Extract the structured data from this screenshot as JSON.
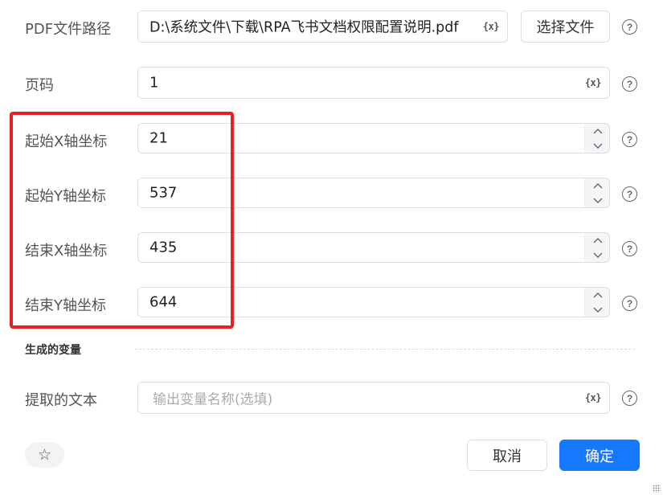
{
  "rows": {
    "pdf_path": {
      "label": "PDF文件路径",
      "value": "D:\\系统文件\\下载\\RPA飞书文档权限配置说明.pdf",
      "var_icon": "{x}",
      "choose_button": "选择文件",
      "help": "?"
    },
    "page": {
      "label": "页码",
      "value": "1",
      "var_icon": "{x}",
      "help": "?"
    },
    "start_x": {
      "label": "起始X轴坐标",
      "value": "21",
      "help": "?"
    },
    "start_y": {
      "label": "起始Y轴坐标",
      "value": "537",
      "help": "?"
    },
    "end_x": {
      "label": "结束X轴坐标",
      "value": "435",
      "help": "?"
    },
    "end_y": {
      "label": "结束Y轴坐标",
      "value": "644",
      "help": "?"
    }
  },
  "section": {
    "title": "生成的变量"
  },
  "output": {
    "label": "提取的文本",
    "placeholder": "输出变量名称(选填)",
    "var_icon": "{x}",
    "help": "?"
  },
  "footer": {
    "star": "☆",
    "cancel": "取消",
    "confirm": "确定"
  },
  "colors": {
    "primary": "#1677ff",
    "highlight": "#e8202a"
  },
  "icons": {
    "spinner_up": "chevron-up-icon",
    "spinner_down": "chevron-down-icon"
  }
}
